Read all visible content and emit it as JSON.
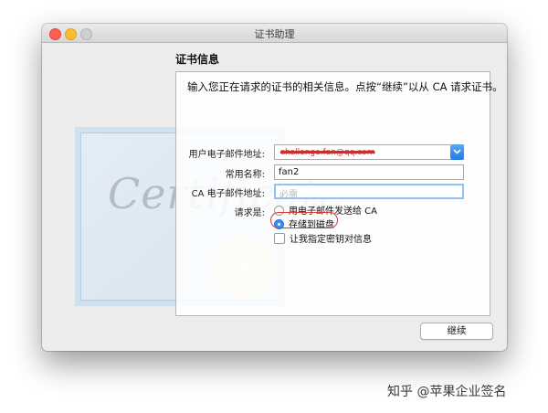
{
  "window": {
    "title": "证书助理"
  },
  "section": {
    "title": "证书信息"
  },
  "intro": "输入您正在请求的证书的相关信息。点按“继续”以从 CA 请求证书。",
  "form": {
    "email_label": "用户电子邮件地址:",
    "email_value": "challenge.fan@qq.com",
    "name_label": "常用名称:",
    "name_value": "fan2",
    "ca_email_label": "CA 电子邮件地址:",
    "ca_email_placeholder": "必需",
    "request_label": "请求是:",
    "option_email": "用电子邮件发送给 CA",
    "option_disk": "存储到磁盘",
    "option_keypair": "让我指定密钥对信息"
  },
  "continue_label": "继续",
  "background_art": "Certificate",
  "watermark": "知乎 @苹果企业签名",
  "colors": {
    "accent": "#3a8ef6",
    "annotation": "#d93a34"
  }
}
